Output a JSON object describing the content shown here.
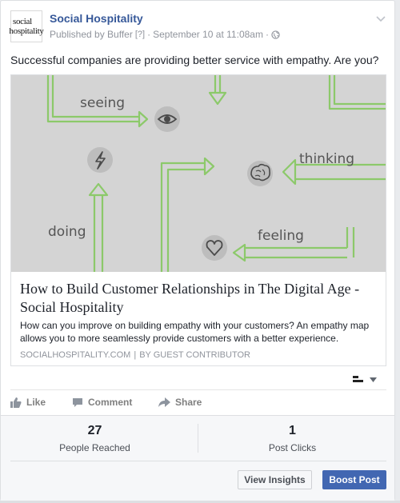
{
  "post": {
    "page_name": "Social Hospitality",
    "avatar_logo_line1": "social",
    "avatar_logo_line2": "hospitality",
    "published_by": "Published by Buffer",
    "help_marker": "[?]",
    "separator": "·",
    "timestamp": "September 10 at 11:08am",
    "message": "Successful companies are providing better service with empathy. Are you?"
  },
  "link_preview": {
    "image_labels": {
      "seeing": "seeing",
      "thinking": "thinking",
      "doing": "doing",
      "feeling": "feeling"
    },
    "title": "How to Build Customer Relationships in The Digital Age - Social Hospitality",
    "description": "How can you improve on building empathy with your customers? An empathy map allows you to more seamlessly provide customers with a better experience.",
    "source_domain": "SOCIALHOSPITALITY.COM",
    "source_sep": "|",
    "source_author": "BY GUEST CONTRIBUTOR"
  },
  "actions": {
    "like": "Like",
    "comment": "Comment",
    "share": "Share"
  },
  "insights": {
    "reached_value": "27",
    "reached_label": "People Reached",
    "clicks_value": "1",
    "clicks_label": "Post Clicks",
    "view_insights_label": "View Insights",
    "boost_post_label": "Boost Post"
  },
  "colors": {
    "link_blue": "#365899",
    "boost_blue": "#4267b2",
    "arrow_green": "#8cc96a",
    "image_bg": "#d4d4d4"
  },
  "icons": [
    "chevron-down-icon",
    "globe-icon",
    "eye-icon",
    "lightning-icon",
    "brain-icon",
    "heart-icon",
    "like-icon",
    "comment-icon",
    "share-icon",
    "audience-dropdown-icon"
  ]
}
